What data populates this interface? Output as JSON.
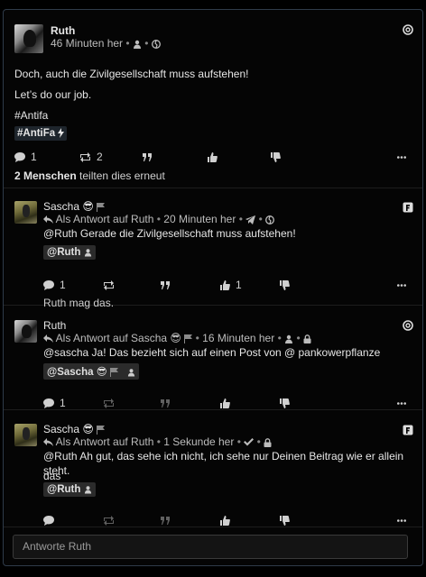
{
  "post": {
    "author": "Ruth",
    "time": "46 Minuten her",
    "lines": [
      "Doch, auch die Zivilgesellschaft muss aufstehen!",
      "Let’s do our job.",
      "#Antifa"
    ],
    "tag": "#AntiFa",
    "comments": "1",
    "reshares": "2",
    "shares_count": "2 Menschen",
    "shares_text": "teilten dies erneut"
  },
  "replies": [
    {
      "author": "Sascha",
      "reply_to": "Als Antwort auf Ruth",
      "time": "20 Minuten her",
      "text": "@Ruth Gerade die Zivilgesellschaft muss aufstehen!",
      "mention": "@Ruth",
      "comments": "1",
      "likes": "1",
      "likes_text": "Ruth mag das."
    },
    {
      "author": "Ruth",
      "reply_to": "Als Antwort auf Sascha",
      "time": "16 Minuten her",
      "text": "@sascha Ja! Das bezieht sich auf einen Post von @ pankowerpflanze",
      "mention": "@Sascha",
      "comments": "1"
    },
    {
      "author": "Sascha",
      "reply_to": "Als Antwort auf Ruth",
      "time": "1 Sekunde her",
      "text_line1": "@Ruth Ah gut, das sehe ich nicht, ich sehe nur Deinen Beitrag wie er allein das",
      "text_line2": "steht.",
      "mention": "@Ruth"
    }
  ],
  "composer": {
    "placeholder": "Antworte Ruth"
  },
  "icons": {
    "emoji": "😎",
    "network_mastodon": "mastodon-icon",
    "network_friendica": "friendica-icon"
  },
  "colors": {
    "background": "#000000",
    "border": "#2f3b4a",
    "tag_bg": "#1e252c"
  }
}
